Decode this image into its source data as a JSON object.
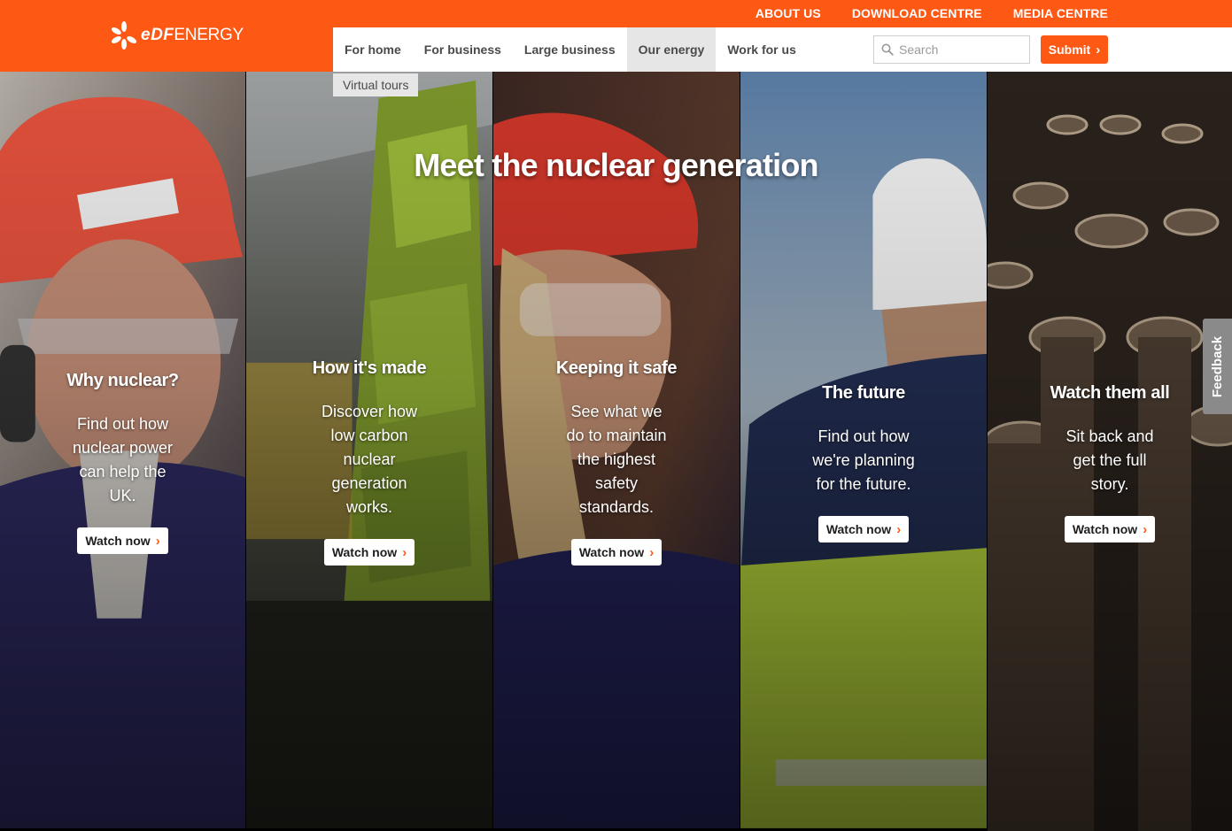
{
  "brand": {
    "logo_edf": "eDF",
    "logo_energy": "ENERGY",
    "accent": "#fe5815"
  },
  "top_links": [
    "ABOUT US",
    "DOWNLOAD CENTRE",
    "MEDIA CENTRE"
  ],
  "nav": {
    "items": [
      "For home",
      "For business",
      "Large business",
      "Our energy",
      "Work for us"
    ],
    "active": "Our energy"
  },
  "search": {
    "placeholder": "Search",
    "submit_label": "Submit"
  },
  "subnav": {
    "label": "Virtual tours"
  },
  "hero": {
    "title": "Meet the nuclear generation"
  },
  "panels": [
    {
      "title": "Why nuclear?",
      "desc": "Find out how nuclear power can help the UK.",
      "button": "Watch now"
    },
    {
      "title": "How it's made",
      "desc": "Discover how low carbon nuclear generation works.",
      "button": "Watch now"
    },
    {
      "title": "Keeping it safe",
      "desc": "See what we do to maintain the highest safety standards.",
      "button": "Watch now"
    },
    {
      "title": "The future",
      "desc": "Find out how we're planning for the future.",
      "button": "Watch now"
    },
    {
      "title": "Watch them all",
      "desc": "Sit back and get the full story.",
      "button": "Watch now"
    }
  ],
  "feedback": {
    "label": "Feedback"
  }
}
